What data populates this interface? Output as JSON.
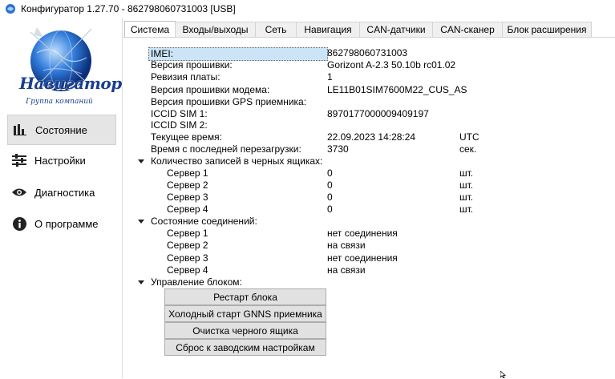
{
  "window": {
    "title": "Конфигуратор 1.27.70 - 862798060731003 [USB]"
  },
  "logo": {
    "brand": "Навигатор",
    "subtitle": "Группа компаний"
  },
  "sidebar": {
    "items": [
      {
        "label": "Состояние",
        "icon": "bar-chart-icon",
        "active": true
      },
      {
        "label": "Настройки",
        "icon": "sliders-icon",
        "active": false
      },
      {
        "label": "Диагностика",
        "icon": "eye-icon",
        "active": false
      },
      {
        "label": "О программе",
        "icon": "info-icon",
        "active": false
      }
    ]
  },
  "tabs": [
    {
      "label": "Система",
      "active": true
    },
    {
      "label": "Входы/выходы"
    },
    {
      "label": "Сеть"
    },
    {
      "label": "Навигация"
    },
    {
      "label": "CAN-датчики"
    },
    {
      "label": "CAN-сканер"
    },
    {
      "label": "Блок расширения"
    }
  ],
  "system": {
    "imei_label": "IMEI:",
    "imei": "862798060731003",
    "firmware_label": "Версия прошивки:",
    "firmware": "Gorizont A-2.3 50.10b rc01.02",
    "board_label": "Ревизия платы:",
    "board": "1",
    "modem_fw_label": "Версия прошивки модема:",
    "modem_fw": "LE11B01SIM7600M22_CUS_AS",
    "gps_fw_label": "Версия прошивки GPS приемника:",
    "gps_fw": "",
    "iccid1_label": "ICCID SIM 1:",
    "iccid1": "8970177000009409197",
    "iccid2_label": "ICCID SIM 2:",
    "iccid2": "",
    "time_label": "Текущее время:",
    "time": "22.09.2023 14:28:24",
    "time_unit": "UTC",
    "uptime_label": "Время с последней перезагрузки:",
    "uptime": "3730",
    "uptime_unit": "сек."
  },
  "blackbox": {
    "group_label": "Количество записей в черных ящиках:",
    "servers": [
      {
        "label": "Сервер 1",
        "value": "0",
        "unit": "шт."
      },
      {
        "label": "Сервер 2",
        "value": "0",
        "unit": "шт."
      },
      {
        "label": "Сервер 3",
        "value": "0",
        "unit": "шт."
      },
      {
        "label": "Сервер 4",
        "value": "0",
        "unit": "шт."
      }
    ]
  },
  "connections": {
    "group_label": "Состояние соединений:",
    "servers": [
      {
        "label": "Сервер 1",
        "value": "нет соединения"
      },
      {
        "label": "Сервер 2",
        "value": "на связи"
      },
      {
        "label": "Сервер 3",
        "value": "нет соединения"
      },
      {
        "label": "Сервер 4",
        "value": "на связи"
      }
    ]
  },
  "control": {
    "group_label": "Управление блоком:",
    "buttons": [
      "Рестарт блока",
      "Холодный старт GNNS приемника",
      "Очистка черного ящика",
      "Сброс к заводским настройкам"
    ]
  },
  "colors": {
    "selection": "#cce4f7",
    "active_nav": "#e5e5e5",
    "logo_blue": "#1a3d8f"
  }
}
